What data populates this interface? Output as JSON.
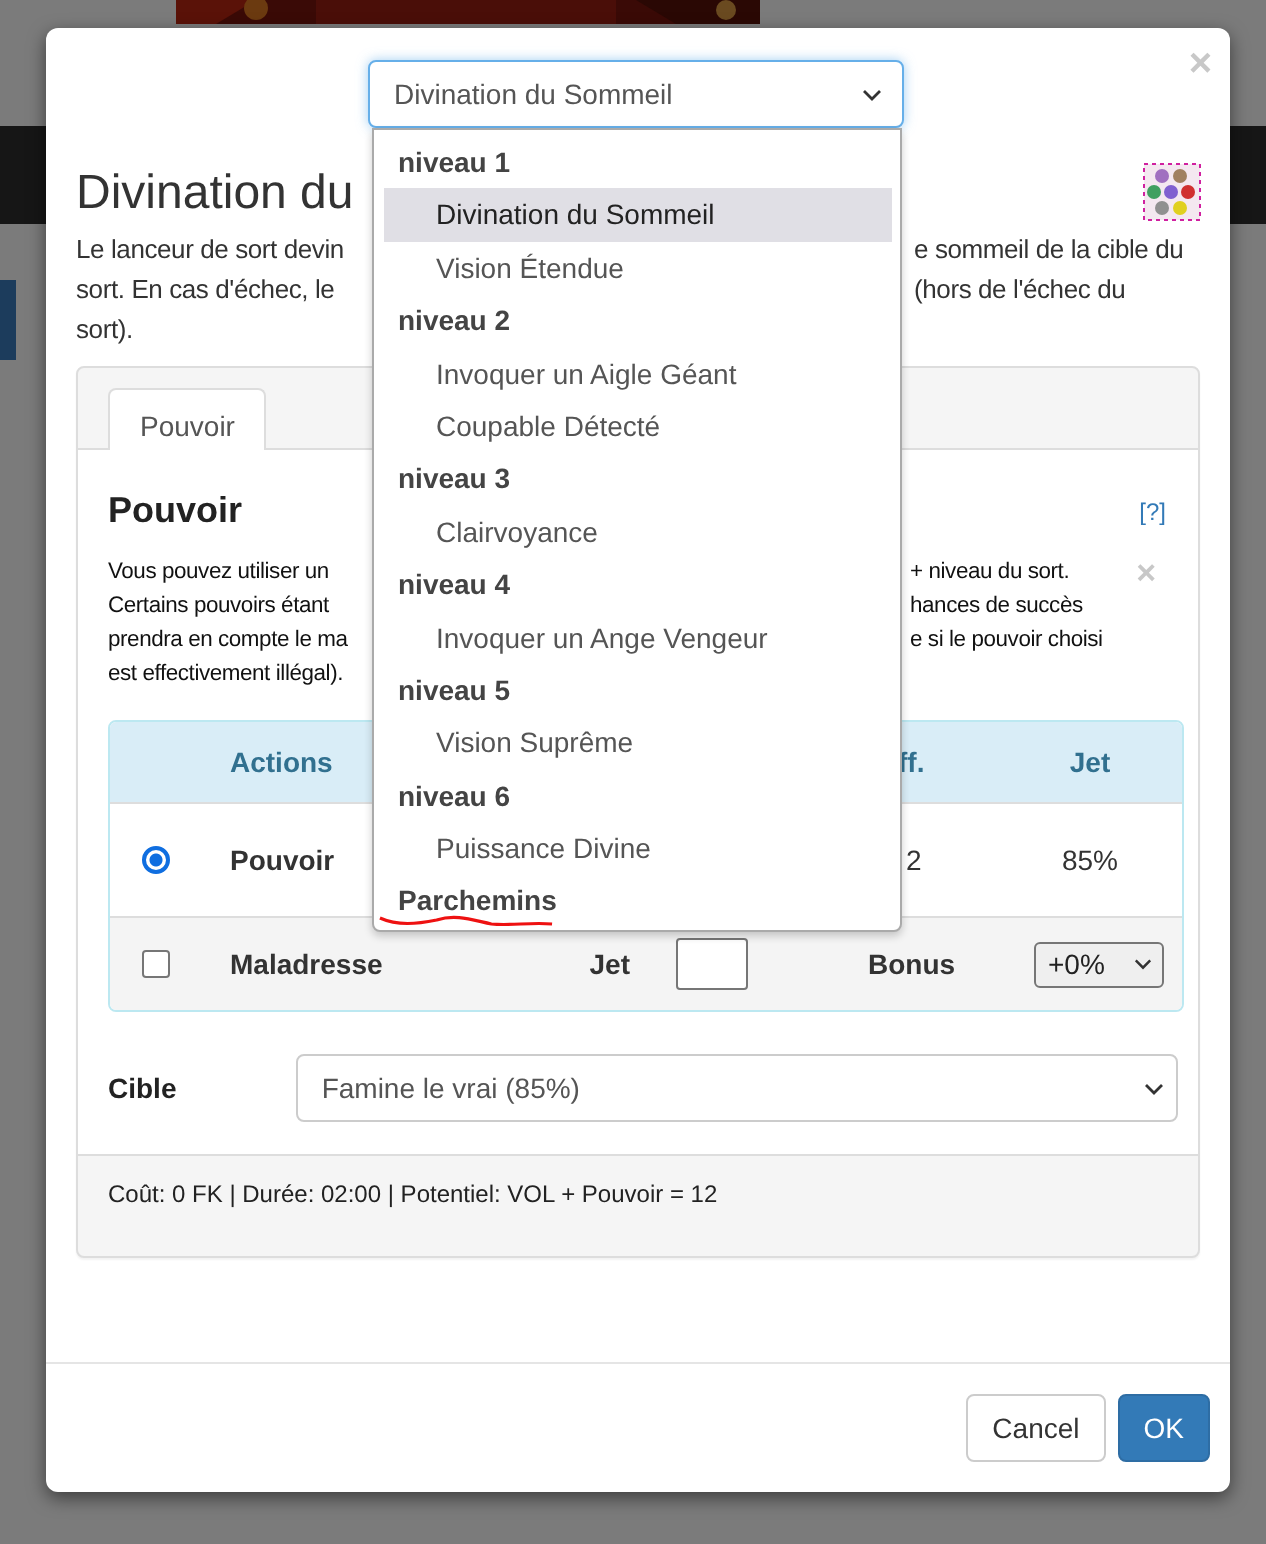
{
  "spell_select": {
    "value": "Divination du Sommeil"
  },
  "spell_menu": {
    "groups": [
      {
        "label": "niveau 1",
        "options": [
          {
            "label": "Divination du Sommeil",
            "selected": true
          },
          {
            "label": "Vision Étendue",
            "selected": false
          }
        ]
      },
      {
        "label": "niveau 2",
        "options": [
          {
            "label": "Invoquer un Aigle Géant",
            "selected": false
          },
          {
            "label": "Coupable Détecté",
            "selected": false
          }
        ]
      },
      {
        "label": "niveau 3",
        "options": [
          {
            "label": "Clairvoyance",
            "selected": false
          }
        ]
      },
      {
        "label": "niveau 4",
        "options": [
          {
            "label": "Invoquer un Ange Vengeur",
            "selected": false
          }
        ]
      },
      {
        "label": "niveau 5",
        "options": [
          {
            "label": "Vision Suprême",
            "selected": false
          }
        ]
      },
      {
        "label": "niveau 6",
        "options": [
          {
            "label": "Puissance Divine",
            "selected": false
          }
        ]
      },
      {
        "label": "Parchemins",
        "underlined": true
      }
    ]
  },
  "close_button": "×",
  "title": "Divination du",
  "description": {
    "left_lines": [
      "Le lanceur de sort devin",
      "sort. En cas d'échec, le",
      "sort)."
    ],
    "right_lines": [
      "e sommeil de la cible du",
      "(hors de l'échec du"
    ]
  },
  "tabs": [
    {
      "label": "Pouvoir",
      "selected": true
    }
  ],
  "pouvoir": {
    "title": "Pouvoir",
    "help_link": "[?]",
    "dismiss": "×",
    "left_lines": [
      "Vous pouvez utiliser un",
      "Certains pouvoirs étant",
      "prendra en compte le ma",
      "est effectivement illégal)."
    ],
    "right_lines": [
      "+ niveau du sort.",
      "hances de succès",
      "e si le pouvoir choisi"
    ]
  },
  "table": {
    "header": {
      "col_1": "Actions",
      "col_2": "ff.",
      "col_3": "Jet"
    },
    "rows": [
      {
        "kind": "radio",
        "selected": true,
        "label": "Pouvoir",
        "value": "2",
        "jet": "85%"
      },
      {
        "kind": "checkbox",
        "checked": false,
        "label": "Maladresse",
        "jet_label": "Jet",
        "bonus_label": "Bonus",
        "bonus": "+0%"
      }
    ]
  },
  "target": {
    "label": "Cible",
    "value": "Famine le vrai (85%)"
  },
  "summary": "Coût: 0 FK | Durée: 02:00 | Potentiel: VOL + Pouvoir = 12",
  "buttons": [
    {
      "label": "Cancel",
      "kind": "default"
    },
    {
      "label": "OK",
      "kind": "primary"
    }
  ]
}
